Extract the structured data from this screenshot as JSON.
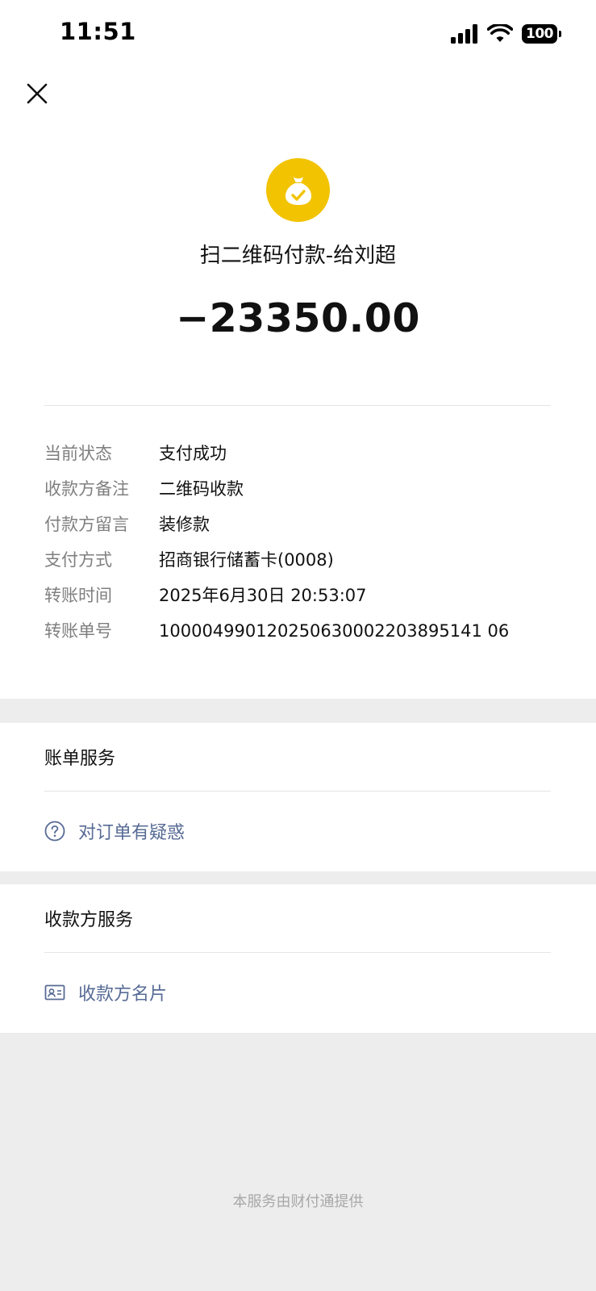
{
  "status_bar": {
    "time": "11:51",
    "battery": "100",
    "icons": [
      "signal-icon",
      "wifi-icon",
      "battery-icon"
    ]
  },
  "header": {
    "close_icon": "close-icon"
  },
  "payment": {
    "avatar_icon": "money-bag-check-icon",
    "avatar_color": "#f2c300",
    "title": "扫二维码付款-给刘超",
    "amount": "−23350.00"
  },
  "details": [
    {
      "label": "当前状态",
      "value": "支付成功"
    },
    {
      "label": "收款方备注",
      "value": "二维码收款"
    },
    {
      "label": "付款方留言",
      "value": "装修款"
    },
    {
      "label": "支付方式",
      "value": "招商银行储蓄卡(0008)"
    },
    {
      "label": "转账时间",
      "value": "2025年6月30日 20:53:07"
    },
    {
      "label": "转账单号",
      "value": "100004990120250630002203895141 06"
    }
  ],
  "bill_service": {
    "title": "账单服务",
    "link_icon": "question-circle-icon",
    "link_label": "对订单有疑惑"
  },
  "payee_service": {
    "title": "收款方服务",
    "link_icon": "contact-card-icon",
    "link_label": "收款方名片"
  },
  "footer": {
    "text": "本服务由财付通提供"
  },
  "colors": {
    "link": "#576b95",
    "background": "#ededed",
    "accent": "#f2c300"
  }
}
